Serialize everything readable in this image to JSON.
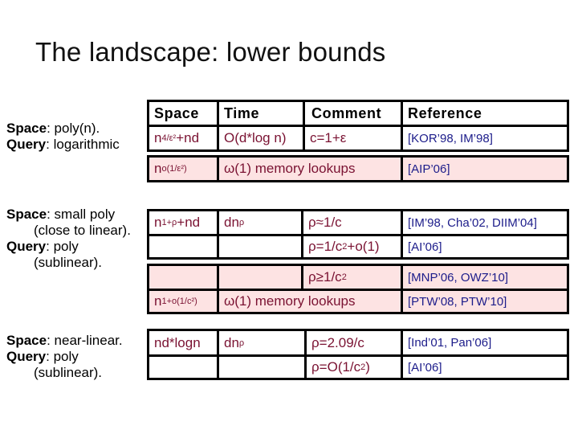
{
  "title": "The landscape: lower bounds",
  "headers": {
    "space": "Space",
    "time": "Time",
    "comment": "Comment",
    "reference": "Reference"
  },
  "regimes": [
    {
      "space_key": "Space",
      "space_val": ": poly(n).",
      "query_key": "Query",
      "query_val": ": logarithmic"
    },
    {
      "space_key": "Space",
      "space_val": ": small poly",
      "space_cont": "(close to linear).",
      "query_key": "Query",
      "query_val": ": poly",
      "query_cont": "(sublinear)."
    },
    {
      "space_key": "Space",
      "space_val": ": near-linear.",
      "query_key": "Query",
      "query_val": ": poly",
      "query_cont": "(sublinear)."
    }
  ],
  "rows": {
    "r1": {
      "space_base": "n",
      "space_sup": "4/ε²",
      "space_tail": "+nd",
      "time": "O(d*log n)",
      "comment": "c=1+ε",
      "reference": "[KOR’98, IM’98]"
    },
    "r2": {
      "space_base": "n",
      "space_sup": "o(1/ε²)",
      "time_comment": "ω(1) memory lookups",
      "reference": "[AIP’06]"
    },
    "r3": {
      "space_base": "n",
      "space_sup": "1+ρ",
      "space_tail": "+nd",
      "time_base": "dn",
      "time_sup": "ρ",
      "comment": "ρ≈1/c",
      "reference": "[IM’98, Cha’02, DIIM’04]"
    },
    "r4": {
      "comment_base": "ρ=1/c",
      "comment_sup": "2",
      "comment_tail": "+o(1)",
      "reference": "[AI’06]"
    },
    "r5": {
      "comment_base": "ρ≥1/c",
      "comment_sup": "2",
      "reference": "[MNP’06, OWZ’10]"
    },
    "r6": {
      "space_base": "n",
      "space_sup": "1+o(1/c²)",
      "time_comment": "ω(1) memory lookups",
      "reference": "[PTW’08, PTW’10]"
    },
    "r7": {
      "space": "nd*logn",
      "time_base": "dn",
      "time_sup": "ρ",
      "comment": "ρ=2.09/c",
      "reference": "[Ind’01, Pan’06]"
    },
    "r8": {
      "comment_base": "ρ=O(1/c",
      "comment_sup": "2",
      "comment_tail": ")",
      "reference": "[AI’06]"
    }
  },
  "colors": {
    "pink_fill": "#fde3e3",
    "math_text": "#7a1232",
    "reference_text": "#1c1c8a"
  }
}
